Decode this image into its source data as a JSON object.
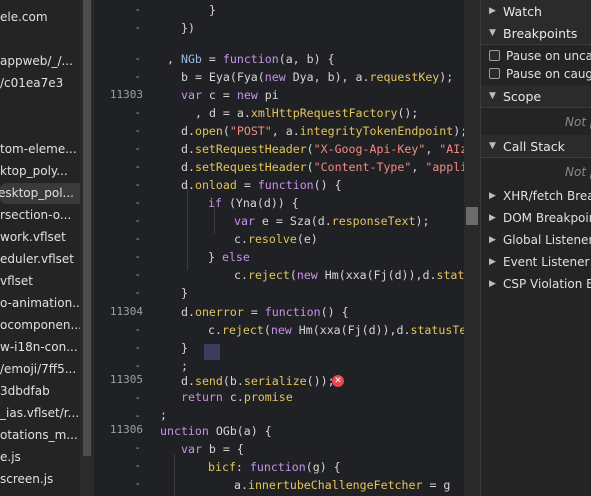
{
  "file_list": [
    "ele.com",
    "",
    "appweb/_/...",
    "/c01ea7e3",
    "",
    "",
    "tom-eleme...",
    "ktop_poly...",
    "esktop_pol...",
    "rsection-o...",
    "work.vflset",
    "eduler.vflset",
    "vflset",
    "o-animation...",
    "ocomponen...",
    "w-i18n-con...",
    "/emoji/7ff5...",
    "3dbdfab",
    "_ias.vflset/r...",
    "otations_m...",
    "e.js",
    "screen.js"
  ],
  "selected_file_index": 8,
  "editor": {
    "line_numbers": [
      "11303",
      "11304",
      "11305",
      "11306"
    ],
    "error_icon": "error-icon"
  },
  "debugger": {
    "watch": "Watch",
    "breakpoints": "Breakpoints",
    "pause_uncaught": "Pause on uncaught exceptions",
    "pause_caught": "Pause on caught exceptions",
    "scope": "Scope",
    "scope_empty": "Not paused",
    "call_stack": "Call Stack",
    "call_stack_empty": "Not paused",
    "xhr": "XHR/fetch Breakpoints",
    "dom": "DOM Breakpoints",
    "global": "Global Listeners",
    "event": "Event Listener Breakpoints",
    "csp": "CSP Violation Breakpoints"
  },
  "colors": {
    "keyword": "#c792ea",
    "function": "#e6c07b",
    "property": "#e3c45d",
    "string": "#f28b82",
    "error": "#e5484d",
    "background": "#202124"
  }
}
